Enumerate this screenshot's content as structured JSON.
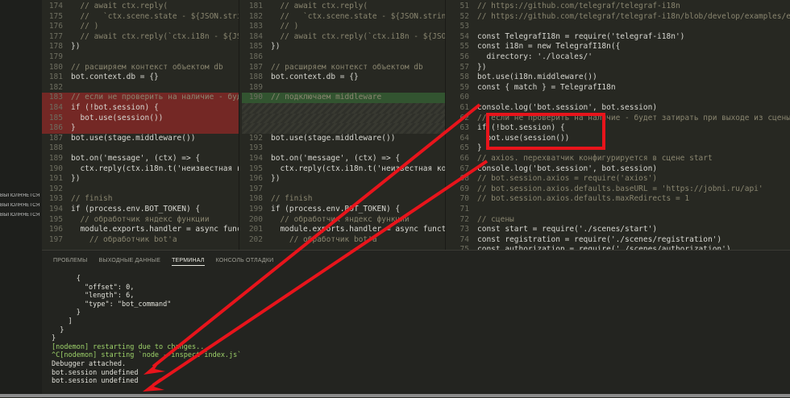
{
  "sidebar": {
    "items": [
      "ВЫПОЛНЯЕТСЯ",
      "ВЫПОЛНЯЕТСЯ",
      "ВЫПОЛНЯЕТСЯ"
    ]
  },
  "left_pane": {
    "lines": [
      {
        "n": "174",
        "t": "  // await ctx.reply(",
        "cls": "comment"
      },
      {
        "n": "175",
        "t": "  //   `ctx.scene.state - ${JSON.stringify",
        "cls": "comment"
      },
      {
        "n": "176",
        "t": "  // )",
        "cls": "comment"
      },
      {
        "n": "177",
        "t": "  // await ctx.reply(`ctx.i18n - ${JSON.st",
        "cls": "comment"
      },
      {
        "n": "178",
        "t": "})",
        "cls": ""
      },
      {
        "n": "179",
        "t": "",
        "cls": ""
      },
      {
        "n": "180",
        "t": "// расширяем контекст объектом db",
        "cls": "comment"
      },
      {
        "n": "181",
        "t": "bot.context.db = {}",
        "cls": ""
      },
      {
        "n": "182",
        "t": "",
        "cls": ""
      },
      {
        "n": "183",
        "t": "// если не проверить на наличие - будет вы",
        "cls": "comment hl-red"
      },
      {
        "n": "184",
        "t": "if (!bot.session) {",
        "cls": "hl-red"
      },
      {
        "n": "185",
        "t": "  bot.use(session())",
        "cls": "hl-red"
      },
      {
        "n": "186",
        "t": "}",
        "cls": "hl-red"
      },
      {
        "n": "187",
        "t": "bot.use(stage.middleware())",
        "cls": ""
      },
      {
        "n": "188",
        "t": "",
        "cls": ""
      },
      {
        "n": "189",
        "t": "bot.on('message', (ctx) => {",
        "cls": ""
      },
      {
        "n": "190",
        "t": "  ctx.reply(ctx.i18n.t('неизвестная команд",
        "cls": ""
      },
      {
        "n": "191",
        "t": "})",
        "cls": ""
      },
      {
        "n": "192",
        "t": "",
        "cls": ""
      },
      {
        "n": "193",
        "t": "// finish",
        "cls": "comment"
      },
      {
        "n": "194",
        "t": "if (process.env.BOT_TOKEN) {",
        "cls": ""
      },
      {
        "n": "195",
        "t": "  // обработчик яндекс функции",
        "cls": "comment"
      },
      {
        "n": "196",
        "t": "  module.exports.handler = async function",
        "cls": ""
      },
      {
        "n": "197",
        "t": "    // обработчик bot'a",
        "cls": "comment"
      }
    ]
  },
  "mid_pane": {
    "lines": [
      {
        "n": "181",
        "t": "  // await ctx.reply(",
        "cls": "comment"
      },
      {
        "n": "182",
        "t": "  //   `ctx.scene.state - ${JSON.stringify",
        "cls": "comment"
      },
      {
        "n": "183",
        "t": "  // )",
        "cls": "comment"
      },
      {
        "n": "184",
        "t": "  // await ctx.reply(`ctx.i18n - ${JSON.st",
        "cls": "comment"
      },
      {
        "n": "185",
        "t": "})",
        "cls": ""
      },
      {
        "n": "186",
        "t": "",
        "cls": ""
      },
      {
        "n": "187",
        "t": "// расширяем контекст объектом db",
        "cls": "comment"
      },
      {
        "n": "188",
        "t": "bot.context.db = {}",
        "cls": ""
      },
      {
        "n": "189",
        "t": "",
        "cls": ""
      },
      {
        "n": "190",
        "t": "// подключаем middleware",
        "cls": "comment hl-green"
      },
      {
        "n": "",
        "t": "",
        "cls": "hatch"
      },
      {
        "n": "",
        "t": "",
        "cls": "hatch"
      },
      {
        "n": "",
        "t": "",
        "cls": "hatch"
      },
      {
        "n": "192",
        "t": "bot.use(stage.middleware())",
        "cls": ""
      },
      {
        "n": "193",
        "t": "",
        "cls": ""
      },
      {
        "n": "194",
        "t": "bot.on('message', (ctx) => {",
        "cls": ""
      },
      {
        "n": "195",
        "t": "  ctx.reply(ctx.i18n.t('неизвестная команд",
        "cls": ""
      },
      {
        "n": "196",
        "t": "})",
        "cls": ""
      },
      {
        "n": "197",
        "t": "",
        "cls": ""
      },
      {
        "n": "198",
        "t": "// finish",
        "cls": "comment"
      },
      {
        "n": "199",
        "t": "if (process.env.BOT_TOKEN) {",
        "cls": ""
      },
      {
        "n": "200",
        "t": "  // обработчик яндекс функции",
        "cls": "comment"
      },
      {
        "n": "201",
        "t": "  module.exports.handler = async function",
        "cls": ""
      },
      {
        "n": "202",
        "t": "    // обработчик bot'a",
        "cls": "comment"
      }
    ]
  },
  "right_pane": {
    "lines": [
      {
        "n": "51",
        "t": "// https://github.com/telegraf/telegraf-i18n",
        "cls": "comment"
      },
      {
        "n": "52",
        "t": "// https://github.com/telegraf/telegraf-i18n/blob/develop/examples/exa",
        "cls": "comment"
      },
      {
        "n": "53",
        "t": "",
        "cls": ""
      },
      {
        "n": "54",
        "t": "const TelegrafI18n = require('telegraf-i18n')",
        "cls": ""
      },
      {
        "n": "55",
        "t": "const i18n = new TelegrafI18n({",
        "cls": ""
      },
      {
        "n": "56",
        "t": "  directory: './locales/'",
        "cls": ""
      },
      {
        "n": "57",
        "t": "})",
        "cls": ""
      },
      {
        "n": "58",
        "t": "bot.use(i18n.middleware())",
        "cls": ""
      },
      {
        "n": "59",
        "t": "const { match } = TelegrafI18n",
        "cls": ""
      },
      {
        "n": "60",
        "t": "",
        "cls": ""
      },
      {
        "n": "61",
        "t": "console.log('bot.session', bot.session)",
        "cls": ""
      },
      {
        "n": "62",
        "t": "// если не проверить на наличие - будет затирать при выходе из сцены",
        "cls": "comment"
      },
      {
        "n": "63",
        "t": "if (!bot.session) {",
        "cls": ""
      },
      {
        "n": "64",
        "t": "  bot.use(session())",
        "cls": ""
      },
      {
        "n": "65",
        "t": "}",
        "cls": ""
      },
      {
        "n": "66",
        "t": "// axios. перехватчик конфигурируется в сцене start",
        "cls": "comment"
      },
      {
        "n": "67",
        "t": "console.log('bot.session', bot.session)",
        "cls": ""
      },
      {
        "n": "68",
        "t": "// bot.session.axios = require('axios')",
        "cls": "comment"
      },
      {
        "n": "69",
        "t": "// bot.session.axios.defaults.baseURL = 'https://jobni.ru/api'",
        "cls": "comment"
      },
      {
        "n": "70",
        "t": "// bot.session.axios.defaults.maxRedirects = 1",
        "cls": "comment"
      },
      {
        "n": "71",
        "t": "",
        "cls": ""
      },
      {
        "n": "72",
        "t": "// сцены",
        "cls": "comment"
      },
      {
        "n": "73",
        "t": "const start = require('./scenes/start')",
        "cls": ""
      },
      {
        "n": "74",
        "t": "const registration = require('./scenes/registration')",
        "cls": ""
      },
      {
        "n": "75",
        "t": "const authorization = require('./scenes/authorization')",
        "cls": ""
      }
    ]
  },
  "panel": {
    "tabs": [
      "ПРОБЛЕМЫ",
      "ВЫХОДНЫЕ ДАННЫЕ",
      "ТЕРМИНАЛ",
      "КОНСОЛЬ ОТЛАДКИ"
    ],
    "active_tab": 2,
    "terminal_lines": [
      {
        "t": "      {",
        "cls": ""
      },
      {
        "t": "        \"offset\": 0,",
        "cls": ""
      },
      {
        "t": "        \"length\": 6,",
        "cls": ""
      },
      {
        "t": "        \"type\": \"bot_command\"",
        "cls": ""
      },
      {
        "t": "      }",
        "cls": ""
      },
      {
        "t": "    ]",
        "cls": ""
      },
      {
        "t": "  }",
        "cls": ""
      },
      {
        "t": "}",
        "cls": ""
      },
      {
        "t": "[nodemon] restarting due to changes...",
        "cls": "green"
      },
      {
        "t": "^C[nodemon] starting `node --inspect index.js`",
        "cls": "green"
      },
      {
        "t": "Debugger attached.",
        "cls": ""
      },
      {
        "t": "bot.session undefined",
        "cls": ""
      },
      {
        "t": "bot.session undefined",
        "cls": ""
      }
    ]
  },
  "colors": {
    "annotation_red": "#e8141b",
    "editor_bg": "#272822"
  }
}
